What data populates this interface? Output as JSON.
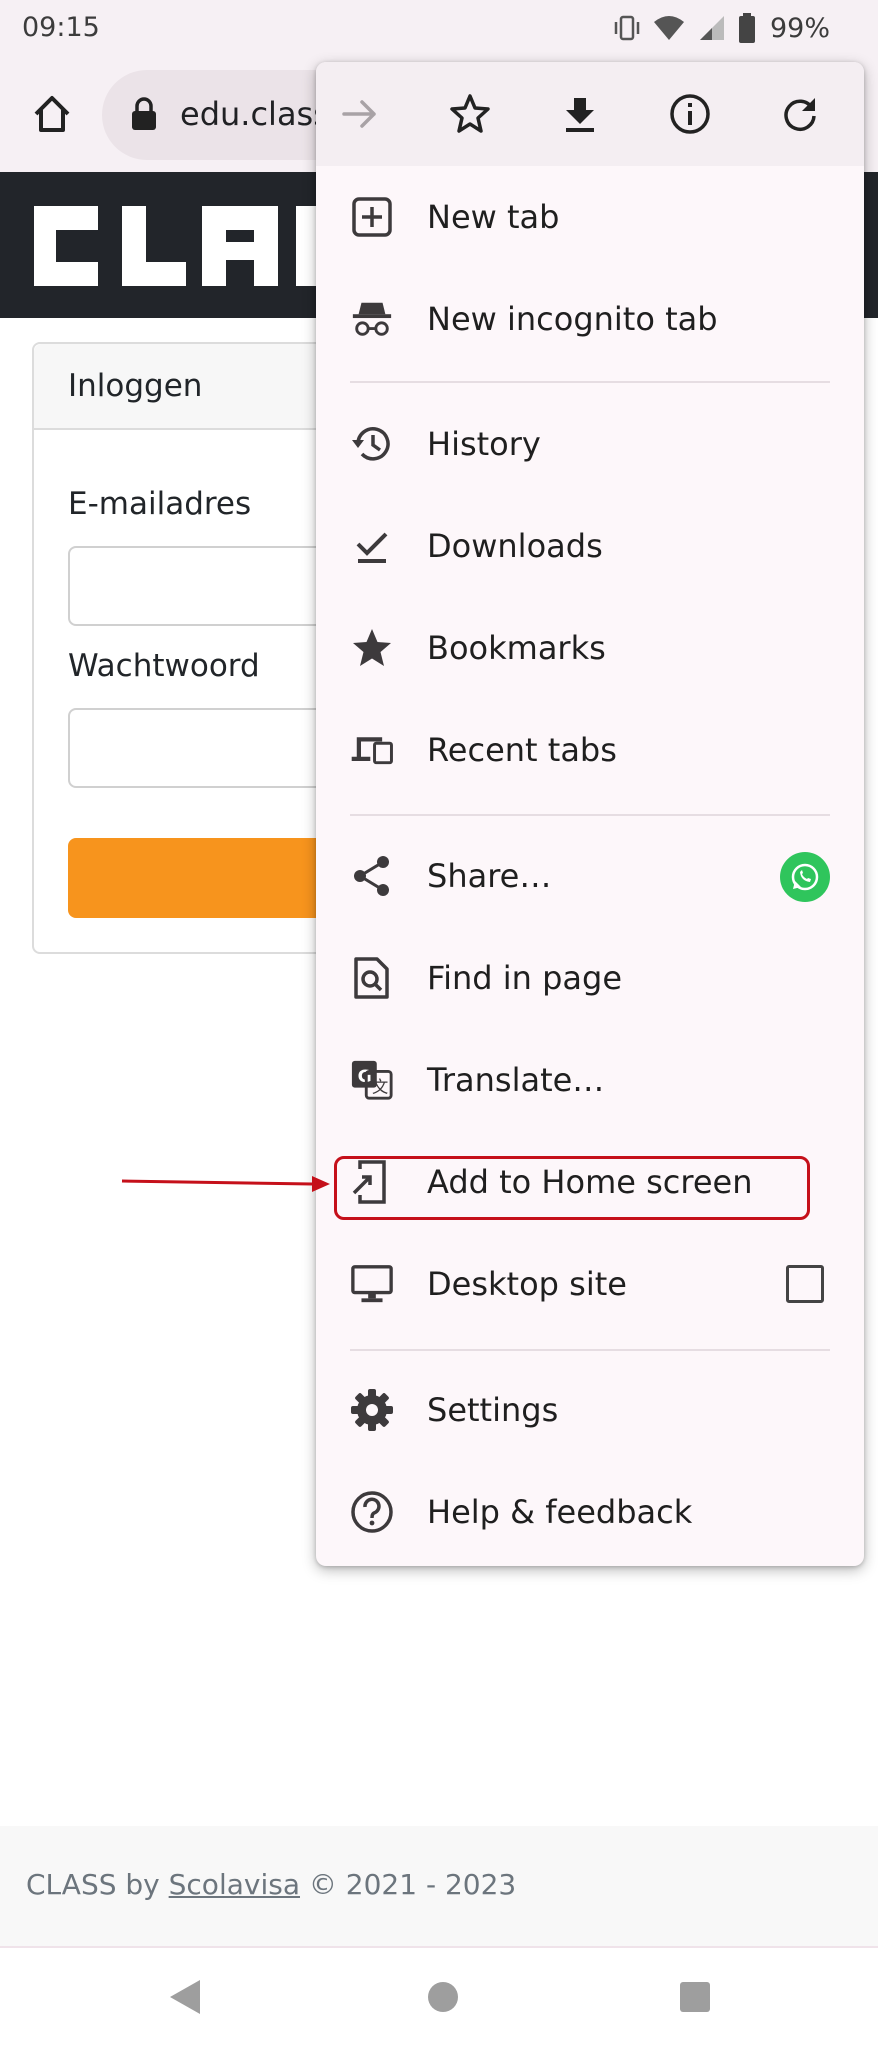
{
  "status_bar": {
    "time": "09:15",
    "battery": "99%",
    "icons": [
      "vibrate-icon",
      "wifi-icon",
      "signal-icon",
      "battery-icon"
    ]
  },
  "toolbar": {
    "url": "edu.class",
    "icons": [
      "home-icon",
      "lock-icon"
    ]
  },
  "page": {
    "logo_text": "CLASS",
    "card_title": "Inloggen",
    "email_label": "E-mailadres",
    "password_label": "Wachtwoord"
  },
  "footer": {
    "prefix": "CLASS by ",
    "link": "Scolavisa",
    "suffix": " © 2021 - 2023"
  },
  "menu": {
    "top_icons": [
      "forward-icon",
      "bookmark-star-icon",
      "download-icon",
      "page-info-icon",
      "reload-icon"
    ],
    "items": [
      {
        "label": "New tab",
        "icon": "new-tab-icon"
      },
      {
        "label": "New incognito tab",
        "icon": "incognito-icon"
      },
      {
        "label": "History",
        "icon": "history-icon"
      },
      {
        "label": "Downloads",
        "icon": "downloads-icon"
      },
      {
        "label": "Bookmarks",
        "icon": "bookmarks-icon"
      },
      {
        "label": "Recent tabs",
        "icon": "devices-icon"
      },
      {
        "label": "Share…",
        "icon": "share-icon",
        "badge": "whatsapp-icon"
      },
      {
        "label": "Find in page",
        "icon": "find-in-page-icon"
      },
      {
        "label": "Translate…",
        "icon": "translate-icon"
      },
      {
        "label": "Add to Home screen",
        "icon": "add-to-home-icon",
        "highlighted": true
      },
      {
        "label": "Desktop site",
        "icon": "desktop-icon",
        "checked": false
      },
      {
        "label": "Settings",
        "icon": "settings-icon"
      },
      {
        "label": "Help & feedback",
        "icon": "help-icon"
      }
    ]
  },
  "colors": {
    "accent_orange": "#f7941d",
    "header_dark": "#22252a",
    "annotation_red": "#c5101a",
    "whatsapp_green": "#2fc55c"
  }
}
